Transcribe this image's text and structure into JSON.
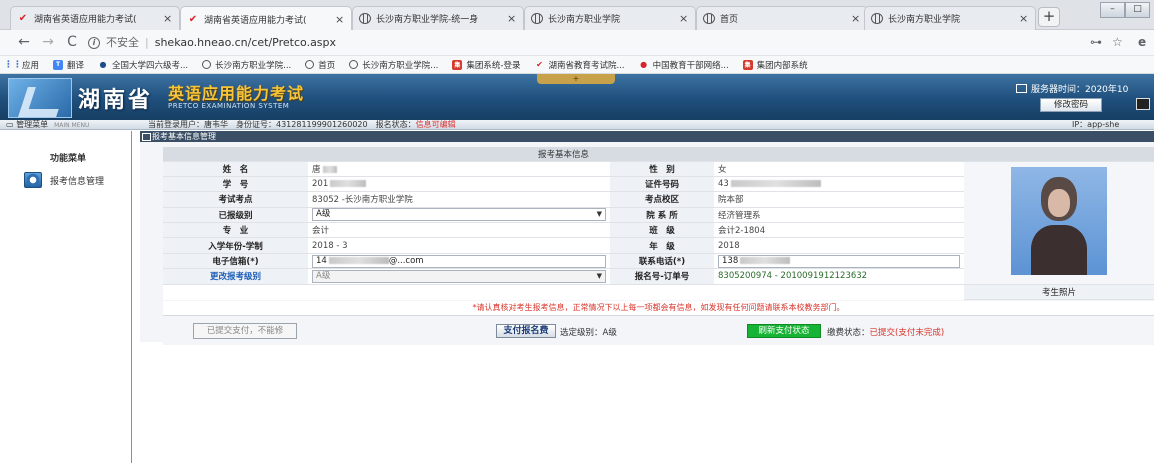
{
  "browser": {
    "tabs": [
      {
        "title": "湖南省英语应用能力考试(",
        "icon": "hn",
        "active": false
      },
      {
        "title": "湖南省英语应用能力考试(",
        "icon": "hn",
        "active": true
      },
      {
        "title": "长沙南方职业学院-统一身",
        "icon": "globe",
        "active": false
      },
      {
        "title": "长沙南方职业学院",
        "icon": "globe",
        "active": false
      },
      {
        "title": "首页",
        "icon": "globe",
        "active": false
      },
      {
        "title": "长沙南方职业学院",
        "icon": "globe",
        "active": false
      }
    ],
    "security_label": "不安全",
    "url": "shekao.hneao.cn/cet/Pretco.aspx",
    "bookmarks": [
      {
        "label": "应用",
        "icon": "apps"
      },
      {
        "label": "翻译",
        "icon": "trans"
      },
      {
        "label": "全国大学四六级考...",
        "icon": "dark"
      },
      {
        "label": "长沙南方职业学院...",
        "icon": "globe"
      },
      {
        "label": "首页",
        "icon": "globe"
      },
      {
        "label": "长沙南方职业学院...",
        "icon": "globe"
      },
      {
        "label": "集团系统-登录",
        "icon": "red"
      },
      {
        "label": "湖南省教育考试院...",
        "icon": "hn"
      },
      {
        "label": "中国教育干部网络...",
        "icon": "cn"
      },
      {
        "label": "集团内部系统",
        "icon": "red"
      }
    ]
  },
  "site": {
    "province": "湖南省",
    "name": "英语应用能力考试",
    "subtitle": "PRETCO EXAMINATION SYSTEM",
    "server_time": "服务器时间：2020年10",
    "change_password": "修改密码"
  },
  "userbar": {
    "menu": "管理菜单",
    "menu_en": "MAIN MENU",
    "user_prefix": "当前登录用户：唐韦华　身份证号：431281199901260020　报名状态：",
    "status": "信息可编辑",
    "ip": "IP：app-she"
  },
  "leftmenu": {
    "title": "功能菜单",
    "item": "报考信息管理"
  },
  "panel": {
    "header": "报考基本信息管理",
    "table_title": "报考基本信息",
    "labels": {
      "name": "姓　名",
      "gender": "性　别",
      "student_no": "学　号",
      "id_no": "证件号码",
      "exam_site": "考试考点",
      "campus": "考点校区",
      "registered_level": "已报级别",
      "department": "院 系 所",
      "major": "专　业",
      "class": "班　级",
      "enroll_year": "入学年份-学制",
      "grade": "年　级",
      "email": "电子信箱(*)",
      "phone": "联系电话(*)",
      "change_level": "更改报考级别",
      "order_no": "报名号-订单号",
      "photo": "考生照片"
    },
    "values": {
      "name": "唐",
      "gender": "女",
      "student_no": "201",
      "id_no": "43",
      "exam_site": "83052 -长沙南方职业学院",
      "campus": "院本部",
      "registered_level": "A级",
      "department": "经济管理系",
      "major": "会计",
      "class": "会计2-1804",
      "enroll_year": "2018 - 3",
      "grade": "2018",
      "email": "14",
      "email_tail": "@...com",
      "phone": "138",
      "change_level": "A级",
      "order_no": "8305200974 - 2010091912123632"
    },
    "notice": "*请认真核对考生报考信息，正常情况下以上每一项都会有信息，如发现有任何问题请联系本校教务部门。"
  },
  "actions": {
    "submitted": "已提交支付，不能修",
    "pay": "支付报名费",
    "selected_level": "选定级别：A级",
    "refresh": "刷新支付状态",
    "pay_status_label": "缴费状态：",
    "pay_status": "已提交(支付未完成)"
  },
  "colors": {
    "banner": "#1f4f7c",
    "accent_gold": "#f7c53a",
    "refresh_green": "#17b334",
    "warning_red": "#d9342b"
  }
}
